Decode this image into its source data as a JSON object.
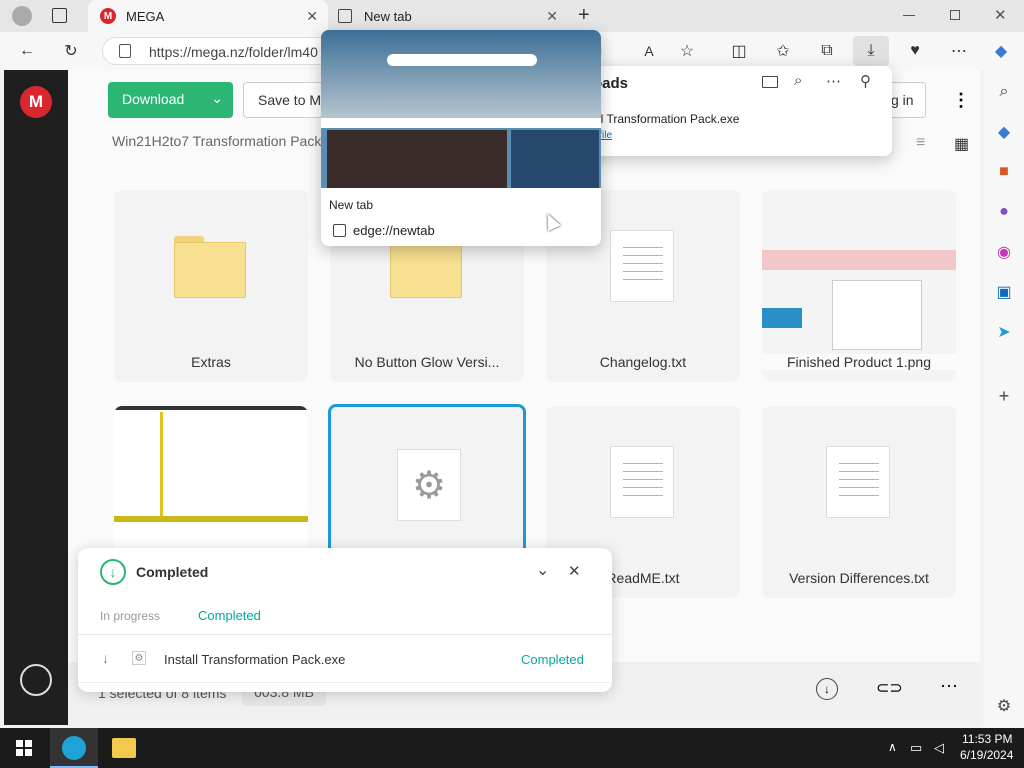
{
  "browser": {
    "tabs": [
      {
        "title": "MEGA",
        "active": true
      },
      {
        "title": "New tab",
        "active": false
      }
    ],
    "url": "https://mega.nz/folder/lm40",
    "new_tab_symbol": "+"
  },
  "tab_preview": {
    "title": "New tab",
    "url": "edge://newtab"
  },
  "downloads_panel": {
    "title": "Downloads",
    "file_name": "Install Transformation Pack.exe",
    "action": "Open file"
  },
  "mega": {
    "download_button": "Download",
    "save_button": "Save to M",
    "login_button": "g in",
    "breadcrumb": "Win21H2to7 Transformation Pack",
    "items": [
      {
        "name": "Extras",
        "type": "folder"
      },
      {
        "name": "No Button Glow Versi...",
        "type": "folder"
      },
      {
        "name": "Changelog.txt",
        "type": "text"
      },
      {
        "name": "Finished Product 1.png",
        "type": "image"
      },
      {
        "name": "",
        "type": "image"
      },
      {
        "name": "",
        "type": "exe"
      },
      {
        "name": "ReadME.txt",
        "type": "text"
      },
      {
        "name": "Version Differences.txt",
        "type": "text"
      }
    ],
    "footer_selection": "1 selected of 8 items",
    "footer_size": "603.8 MB"
  },
  "transfer": {
    "header": "Completed",
    "tab_in_progress": "In progress",
    "tab_completed": "Completed",
    "file_name": "Install Transformation Pack.exe",
    "status": "Completed"
  },
  "taskbar": {
    "time": "11:53 PM",
    "date": "6/19/2024"
  },
  "colors": {
    "mega_red": "#d9272e",
    "download_green": "#2bb673",
    "teal": "#00a9a0",
    "selected_border": "#1a9bd7"
  }
}
